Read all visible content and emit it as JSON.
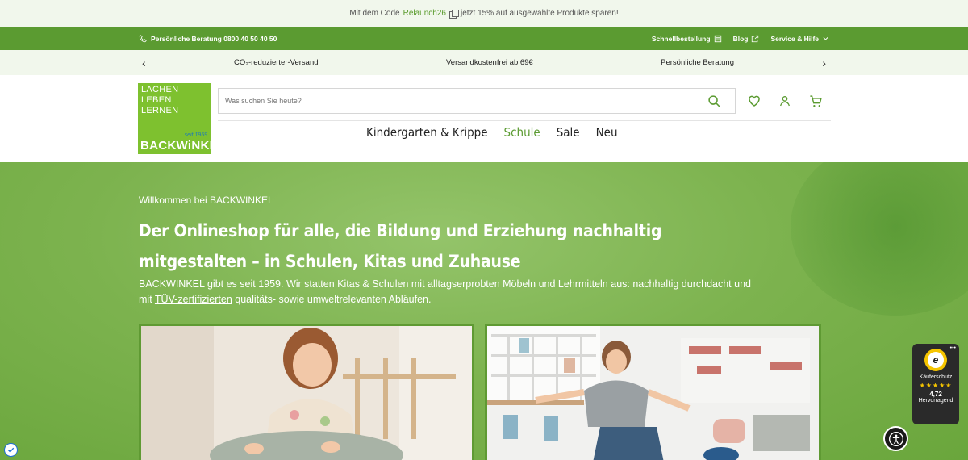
{
  "promo": {
    "prefix": "Mit dem Code",
    "code": "Relaunch26",
    "suffix": "jetzt 15% auf ausgewählte Produkte sparen!"
  },
  "topbar": {
    "phone": "Persönliche Beratung 0800 40 50 40 50",
    "quick_order": "Schnellbestellung",
    "blog": "Blog",
    "service": "Service & Hilfe"
  },
  "usp": {
    "items": [
      "CO₂-reduzierter-Versand",
      "Versandkostenfrei ab 69€",
      "Persönliche Beratung"
    ]
  },
  "logo": {
    "line1": "LACHEN",
    "line2": "LEBEN",
    "line3": "LERNEN",
    "since": "seit 1959",
    "brand": "BACKWiNKEL"
  },
  "search": {
    "placeholder": "Was suchen Sie heute?"
  },
  "nav": {
    "items": [
      {
        "label": "Kindergarten & Krippe"
      },
      {
        "label": "Schule"
      },
      {
        "label": "Sale"
      },
      {
        "label": "Neu"
      }
    ]
  },
  "hero": {
    "welcome": "Willkommen bei BACKWINKEL",
    "headline_1": "Der Onlineshop für alle, die Bildung und Erziehung nachhaltig",
    "headline_2": "mitgestalten – in Schulen, Kitas und Zuhause",
    "desc_1": "BACKWINKEL gibt es seit 1959. Wir statten Kitas & Schulen mit alltagserprobten Möbeln und Lehrmitteln aus: nachhaltig durchdacht und",
    "desc_2a": "mit",
    "desc_link": "TÜV-zertifizierten",
    "desc_2b": "qualitäts- sowie umweltrelevanten Abläufen."
  },
  "trusted": {
    "label": "Käuferschutz",
    "score": "4,72",
    "rating": "Hervorragend",
    "stars": "★★★★★",
    "seal_letter": "e"
  },
  "colors": {
    "brand_green": "#5b9b31",
    "logo_green": "#7ec12f",
    "promo_bg": "#f1f7ec"
  }
}
